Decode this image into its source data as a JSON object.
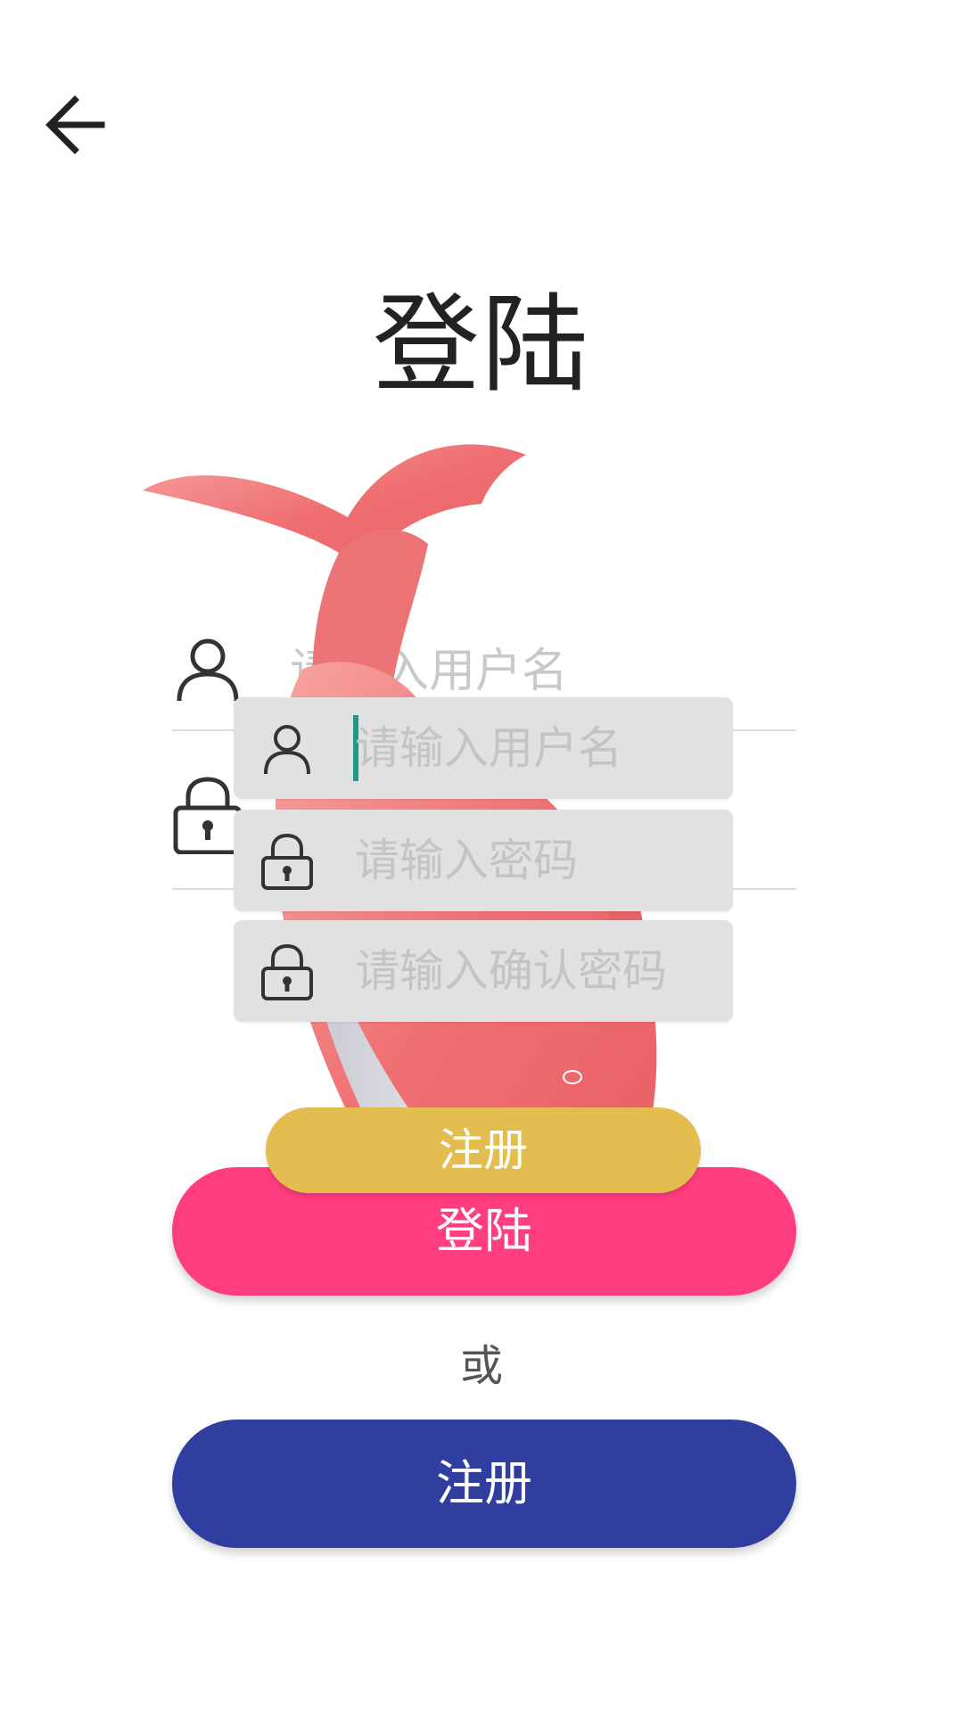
{
  "header": {
    "back_icon": "arrow-left-icon",
    "title": "登陆"
  },
  "login_form": {
    "username_placeholder": "请输入用户名",
    "username_icon": "user-icon",
    "password_icon": "lock-icon"
  },
  "register_popup": {
    "username_placeholder": "请输入用户名",
    "password_placeholder": "请输入密码",
    "confirm_placeholder": "请输入确认密码",
    "user_icon": "user-icon",
    "lock_icon": "lock-icon",
    "register_label": "注册"
  },
  "actions": {
    "login_label": "登陆",
    "or_label": "或",
    "register_label": "注册"
  },
  "colors": {
    "login_button": "#ff3d7f",
    "register_button": "#303f9f",
    "popup_register_button": "#e3bd4f",
    "caret": "#1e9987"
  }
}
